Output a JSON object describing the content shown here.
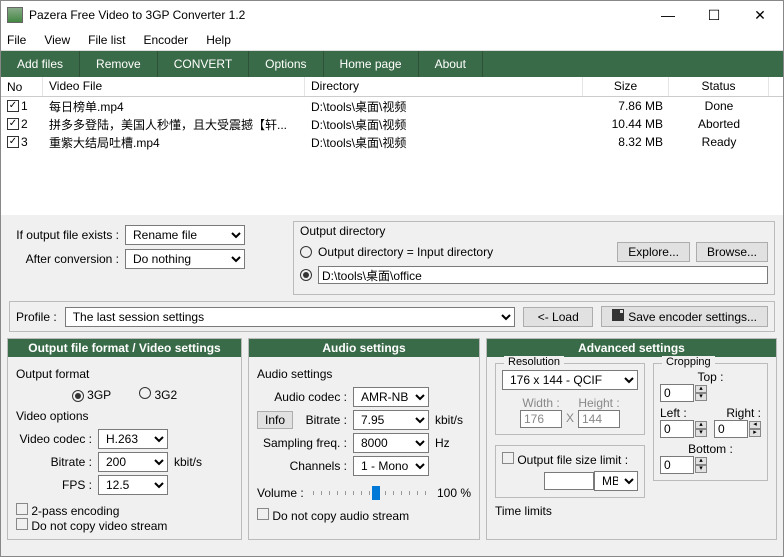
{
  "window": {
    "title": "Pazera Free Video to 3GP Converter 1.2"
  },
  "menu": {
    "file": "File",
    "view": "View",
    "filelist": "File list",
    "encoder": "Encoder",
    "help": "Help"
  },
  "toolbar": {
    "add": "Add files",
    "remove": "Remove",
    "convert": "CONVERT",
    "options": "Options",
    "home": "Home page",
    "about": "About"
  },
  "cols": {
    "no": "No",
    "file": "Video File",
    "dir": "Directory",
    "size": "Size",
    "status": "Status"
  },
  "rows": [
    {
      "n": "1",
      "file": "每日榜单.mp4",
      "dir": "D:\\tools\\桌面\\视频",
      "size": "7.86 MB",
      "status": "Done"
    },
    {
      "n": "2",
      "file": "拼多多登陆，美国人秒懂，且大受震撼【轩...",
      "dir": "D:\\tools\\桌面\\视频",
      "size": "10.44 MB",
      "status": "Aborted"
    },
    {
      "n": "3",
      "file": "重紫大结局吐槽.mp4",
      "dir": "D:\\tools\\桌面\\视频",
      "size": "8.32 MB",
      "status": "Ready"
    }
  ],
  "mid": {
    "exists_label": "If output file exists :",
    "exists_value": "Rename file",
    "after_label": "After conversion :",
    "after_value": "Do nothing",
    "outdir_legend": "Output directory",
    "outdir_opt1": "Output directory = Input directory",
    "outdir_path": "D:\\tools\\桌面\\office",
    "explore": "Explore...",
    "browse": "Browse..."
  },
  "profile": {
    "label": "Profile :",
    "value": "The last session settings",
    "load": "<- Load",
    "save": "Save encoder settings..."
  },
  "p1": {
    "title": "Output file format / Video settings",
    "outfmt": "Output format",
    "g3gp": "3GP",
    "g3g2": "3G2",
    "vopts": "Video options",
    "vcodec_l": "Video codec :",
    "vcodec_v": "H.263",
    "bitrate_l": "Bitrate :",
    "bitrate_v": "200",
    "bitrate_u": "kbit/s",
    "fps_l": "FPS :",
    "fps_v": "12.5",
    "twopass": "2-pass encoding",
    "nocopy": "Do not copy video stream"
  },
  "p2": {
    "title": "Audio settings",
    "hdr": "Audio settings",
    "acodec_l": "Audio codec :",
    "acodec_v": "AMR-NB",
    "info": "Info",
    "abit_l": "Bitrate :",
    "abit_v": "7.95",
    "abit_u": "kbit/s",
    "sfreq_l": "Sampling freq. :",
    "sfreq_v": "8000",
    "sfreq_u": "Hz",
    "chan_l": "Channels :",
    "chan_v": "1 - Mono",
    "vol_l": "Volume :",
    "vol_v": "100 %",
    "nocopy": "Do not copy audio stream"
  },
  "p3": {
    "title": "Advanced settings",
    "res_l": "Resolution",
    "res_v": "176 x 144 - QCIF",
    "w_l": "Width :",
    "w_v": "176",
    "x": "X",
    "h_l": "Height :",
    "h_v": "144",
    "limit": "Output file size limit :",
    "mb": "MB",
    "crop_l": "Cropping",
    "top": "Top :",
    "left": "Left :",
    "right": "Right :",
    "bottom": "Bottom :",
    "zero": "0",
    "time": "Time limits"
  }
}
